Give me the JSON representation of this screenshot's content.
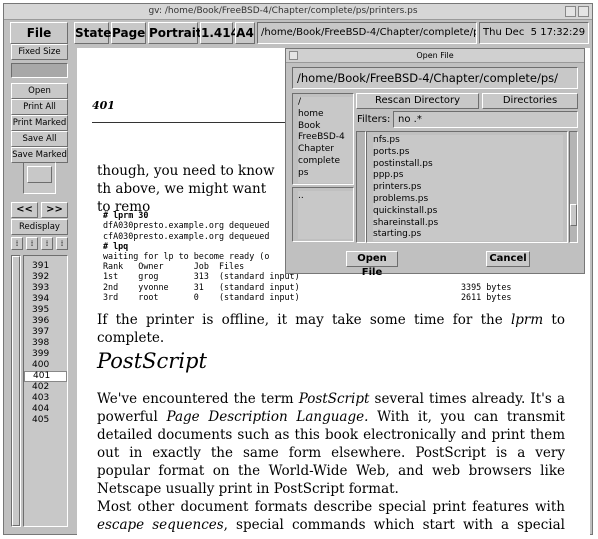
{
  "window": {
    "title": "gv: /home/Book/FreeBSD-4/Chapter/complete/ps/printers.ps"
  },
  "toolbar": {
    "file": "File",
    "state": "State",
    "page": "Page",
    "orientation": "Portrait",
    "scale": "1.414",
    "paper": "A4",
    "filename": "/home/Book/FreeBSD-4/Chapter/complete/ps/prin",
    "date": "Thu Dec  5 17:32:29 20"
  },
  "sidebar": {
    "fixed_size": "Fixed Size",
    "open": "Open",
    "print_all": "Print All",
    "print_marked": "Print Marked",
    "save_all": "Save All",
    "save_marked": "Save Marked",
    "prev": "<<",
    "next": ">>",
    "redisplay": "Redisplay",
    "pages": [
      "391",
      "392",
      "393",
      "394",
      "395",
      "396",
      "397",
      "398",
      "399",
      "400",
      "401",
      "402",
      "403",
      "404",
      "405"
    ],
    "current_page": "401"
  },
  "document": {
    "page_number": "401",
    "p1": "though, you need to know th above, we might want to remo",
    "cmd1": "# lprm 30",
    "out1": "dfA030presto.example.org dequeued\ncfA030presto.example.org dequeued",
    "cmd2": "# lpq",
    "lpq_status": "waiting for lp to become ready (o",
    "lpq_header": "Rank   Owner      Job  Files",
    "lpq_rows": [
      {
        "rank": "1st",
        "owner": "grog",
        "job": "313",
        "files": "(standard input)",
        "size": ""
      },
      {
        "rank": "2nd",
        "owner": "yvonne",
        "job": "31",
        "files": "(standard input)",
        "size": "3395 bytes"
      },
      {
        "rank": "3rd",
        "owner": "root",
        "job": "0",
        "files": "(standard input)",
        "size": "2611 bytes"
      }
    ],
    "p2_pre": "If the printer is offline, it may take some time for the ",
    "p2_em": "lprm",
    "p2_post": " to complete.",
    "heading": "PostScript",
    "p3_a": "We've encountered the term ",
    "p3_em1": "PostScript",
    "p3_b": " several times already.  It's a powerful ",
    "p3_em2": "Page Description Language.",
    "p3_c": "  With it, you can transmit detailed documents such as this book electronically and print them out in exactly the same form elsewhere.  PostScript is a very popular format on the World-Wide Web, and web browsers like Netscape usually print in PostScript format.",
    "p4_a": "Most other document formats describe special print features with ",
    "p4_em": "escape sequences",
    "p4_b": ", special commands which start with a special character.  For"
  },
  "open_dialog": {
    "title": "Open File",
    "path": "/home/Book/FreeBSD-4/Chapter/complete/ps/",
    "rescan": "Rescan Directory",
    "directories": "Directories",
    "filters_label": "Filters:",
    "filters_value": "no .*",
    "dirs": [
      "/",
      "home",
      "Book",
      "FreeBSD-4",
      "Chapter",
      "complete",
      "ps"
    ],
    "subdirs": [
      ".."
    ],
    "files": [
      "nfs.ps",
      "ports.ps",
      "postinstall.ps",
      "ppp.ps",
      "printers.ps",
      "problems.ps",
      "quickinstall.ps",
      "shareinstall.ps",
      "starting.ps"
    ],
    "open_button": "Open File",
    "cancel_button": "Cancel"
  }
}
